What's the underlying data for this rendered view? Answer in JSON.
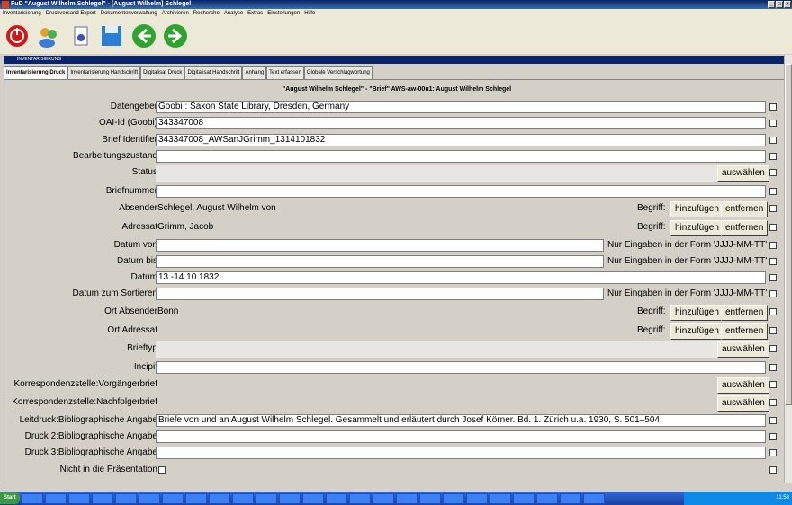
{
  "window": {
    "title": "FuD \"August Wilhelm Schlegel\" - [August Wilhelm] Schlegel"
  },
  "menu": [
    "Inventarisierung",
    "Druckversand Export",
    "Dokumentenverwaltung",
    "Archivieren",
    "Recherche",
    "Analyse",
    "Extras",
    "Einstellungen",
    "Hilfe"
  ],
  "inner_window": {
    "title": "INVENTARISIERUNG"
  },
  "tabs": [
    "Inventarisierung Druck",
    "Inventarisierung Handschrift",
    "Digitalisat Druck",
    "Digitalisat Handschrift",
    "Anhang",
    "Text erfassen",
    "Globale Verschlagwortung"
  ],
  "heading": "\"August Wilhelm Schlegel\" - \"Brief\" AWS-aw-00u1: August Wilhelm Schlegel",
  "fields": {
    "datengeber": {
      "label": "Datengeber",
      "value": "Goobi : Saxon State Library, Dresden, Germany"
    },
    "oai_id": {
      "label": "OAI-Id (Goobi)",
      "value": "343347008"
    },
    "brief_identifier": {
      "label": "Brief Identifier",
      "value": "343347008_AWSanJGrimm_1314101832"
    },
    "bearbeitungszustand": {
      "label": "Bearbeitungszustand",
      "value": ""
    },
    "status": {
      "label": "Status",
      "button": "auswählen"
    },
    "briefnummer": {
      "label": "Briefnummer",
      "value": ""
    },
    "absender": {
      "label": "Absender",
      "value": "Schlegel, August Wilhelm von",
      "begriff": "Begriff:",
      "add": "hinzufügen",
      "remove": "entfernen"
    },
    "adressat": {
      "label": "Adressat",
      "value": "Grimm, Jacob",
      "begriff": "Begriff:",
      "add": "hinzufügen",
      "remove": "entfernen"
    },
    "datum_von": {
      "label": "Datum von",
      "value": "",
      "hint": "Nur Eingaben in der Form 'JJJJ-MM-TT'"
    },
    "datum_bis": {
      "label": "Datum bis",
      "value": "",
      "hint": "Nur Eingaben in der Form 'JJJJ-MM-TT'"
    },
    "datum": {
      "label": "Datum",
      "value": "13.-14.10.1832"
    },
    "datum_sortieren": {
      "label": "Datum zum Sortieren",
      "value": "",
      "hint": "Nur Eingaben in der Form 'JJJJ-MM-TT'"
    },
    "ort_absender": {
      "label": "Ort Absender",
      "value": "Bonn",
      "begriff": "Begriff:",
      "add": "hinzufügen",
      "remove": "entfernen"
    },
    "ort_adressat": {
      "label": "Ort Adressat",
      "value": "",
      "begriff": "Begriff:",
      "add": "hinzufügen",
      "remove": "entfernen"
    },
    "brieftyp": {
      "label": "Brieftyp",
      "button": "auswählen"
    },
    "incipit": {
      "label": "Incipit",
      "value": ""
    },
    "vorgaenger": {
      "label": "Korrespondenzstelle:Vorgängerbrief",
      "button": "auswählen"
    },
    "nachfolger": {
      "label": "Korrespondenzstelle:Nachfolgerbrief",
      "button": "auswählen"
    },
    "leitdruck": {
      "label": "Leitdruck:Bibliographische Angabe",
      "value": "Briefe von und an August Wilhelm Schlegel. Gesammelt und erläutert durch Josef Körner. Bd. 1. Zürich u.a. 1930, S. 501–504."
    },
    "druck2": {
      "label": "Druck 2:Bibliographische Angabe",
      "value": ""
    },
    "druck3": {
      "label": "Druck 3:Bibliographische Angabe",
      "value": ""
    },
    "praesentation": {
      "label": "Nicht in die Präsentation"
    }
  },
  "taskbar": {
    "start": "Start",
    "clock": "11:53"
  }
}
